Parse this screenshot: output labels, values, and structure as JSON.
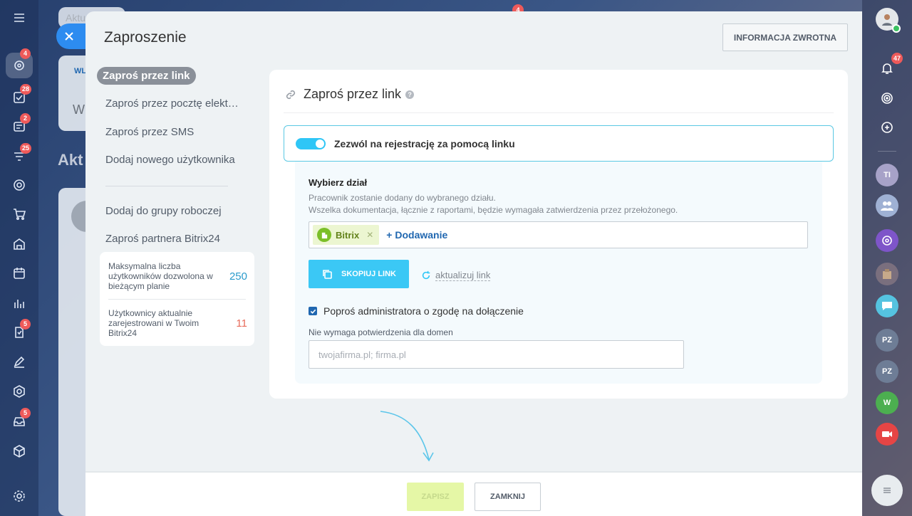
{
  "window": {
    "title": "Zaproszenie"
  },
  "background": {
    "tab_text": "Aktu",
    "heading_text": "Akt",
    "card_tab_text": "WL",
    "card_text": "W"
  },
  "left_rail": {
    "badges": {
      "crm": "4",
      "tasks": "28",
      "feed": "2",
      "sales": "25",
      "automation": "5",
      "robots": "5"
    },
    "top_badge": "4"
  },
  "right_rail": {
    "notifications_badge": "47",
    "avatars": [
      "TI",
      "PZ",
      "PZ",
      "W"
    ]
  },
  "header": {
    "feedback_label": "INFORMACJA ZWROTNA"
  },
  "menu": {
    "items": [
      {
        "label": "Zaproś przez link"
      },
      {
        "label": "Zaproś przez pocztę elektroniczną"
      },
      {
        "label": "Zaproś przez SMS"
      },
      {
        "label": "Dodaj nowego użytkownika"
      },
      {
        "label": "Dodaj do grupy roboczej"
      },
      {
        "label": "Zaproś partnera Bitrix24"
      }
    ]
  },
  "stats": {
    "max_users_label": "Maksymalna liczba użytkowników dozwolona w bieżącym planie",
    "max_users_value": "250",
    "registered_label": "Użytkownicy aktualnie zarejestrowani w Twoim Bitrix24",
    "registered_value": "11"
  },
  "card": {
    "title": "Zaproś przez link",
    "help_glyph": "?",
    "toggle_label": "Zezwól na rejestrację za pomocą linku",
    "department": {
      "title": "Wybierz dział",
      "desc1": "Pracownik zostanie dodany do wybranego działu.",
      "desc2": "Wszelka dokumentacja, łącznie z raportami, będzie wymagała zatwierdzenia przez przełożonego.",
      "selected": "Bitrix",
      "add_label": "+ Dodawanie"
    },
    "copy_link_label": "SKOPIUJ LINK",
    "refresh_label": "aktualizuj link",
    "approval_label": "Poproś administratora o zgodę na dołączenie",
    "domains_label": "Nie wymaga potwierdzenia dla domen",
    "domains_placeholder": "twojafirma.pl; firma.pl",
    "domains_value": ""
  },
  "footer": {
    "save_label": "ZAPISZ",
    "close_label": "ZAMKNIJ"
  },
  "colors": {
    "accent": "#2fc6f6",
    "toggle_border": "#5bc8e3",
    "stat_primary": "#2a9bcc",
    "stat_danger": "#e86c5b",
    "save_bg": "#e5f7a6",
    "menu_active_bg": "#8a9099"
  }
}
